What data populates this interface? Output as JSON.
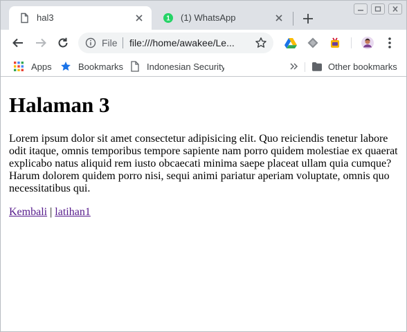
{
  "tabs": [
    {
      "title": "hal3",
      "active": true
    },
    {
      "title": "(1) WhatsApp",
      "active": false,
      "badge": "1"
    }
  ],
  "address_bar": {
    "scheme_label": "File",
    "url": "file:///home/awakee/Le..."
  },
  "bookmarks": {
    "items": [
      {
        "label": "Apps",
        "icon": "apps-grid-icon"
      },
      {
        "label": "Bookmarks",
        "icon": "star-icon"
      },
      {
        "label": "Indonesian Security",
        "icon": "page-icon"
      }
    ],
    "other_label": "Other bookmarks"
  },
  "page": {
    "heading": "Halaman 3",
    "paragraph": "Lorem ipsum dolor sit amet consectetur adipisicing elit. Quo reiciendis tenetur labore odit itaque, omnis temporibus tempore sapiente nam porro quidem molestiae ex quaerat explicabo natus aliquid rem iusto obcaecati minima saepe placeat ullam quia cumque? Harum dolorem quidem porro nisi, sequi animi pariatur aperiam voluptate, omnis quo necessitatibus qui.",
    "link_back": "Kembali",
    "link_separator": "|",
    "link_next": "latihan1"
  },
  "colors": {
    "tabstrip_bg": "#dee1e6",
    "whatsapp_green": "#25d366",
    "visited_link": "#551a8b",
    "google_blue": "#1a73e8"
  }
}
